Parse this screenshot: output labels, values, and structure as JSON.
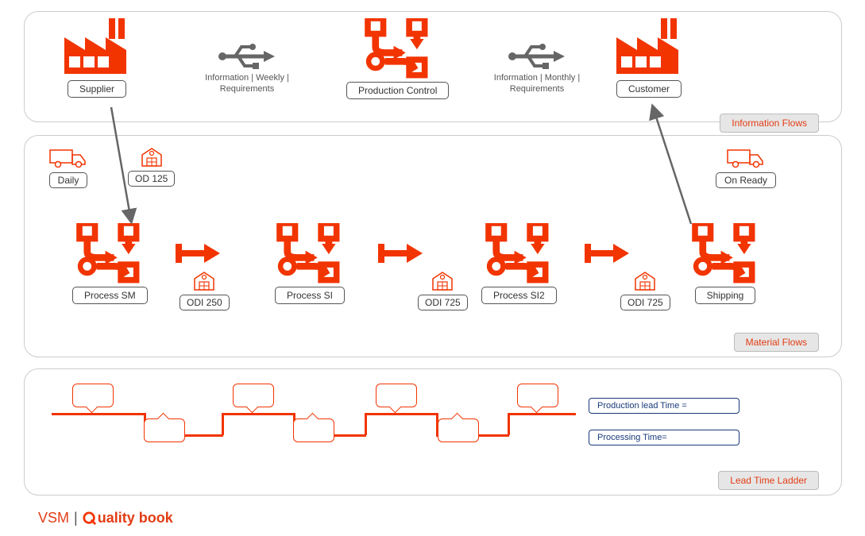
{
  "info": {
    "badge": "Information Flows",
    "supplier": "Supplier",
    "info1": "Information | Weekly | Requirements",
    "production_control": "Production Control",
    "info2": "Information | Monthly | Requirements",
    "customer": "Customer"
  },
  "mat": {
    "badge": "Material Flows",
    "daily": "Daily",
    "od125": "OD 125",
    "process_sm": "Process SM",
    "odi250": "ODI 250",
    "process_si": "Process SI",
    "odi725a": "ODI 725",
    "process_si2": "Process SI2",
    "odi725b": "ODI 725",
    "shipping": "Shipping",
    "on_ready": "On Ready"
  },
  "lead": {
    "badge": "Lead Time Ladder",
    "prod_lead": "Production lead Time =",
    "proc_time": "Processing Time="
  },
  "footer": {
    "vsm": "VSM",
    "sep": "|",
    "brand": "uality book"
  }
}
